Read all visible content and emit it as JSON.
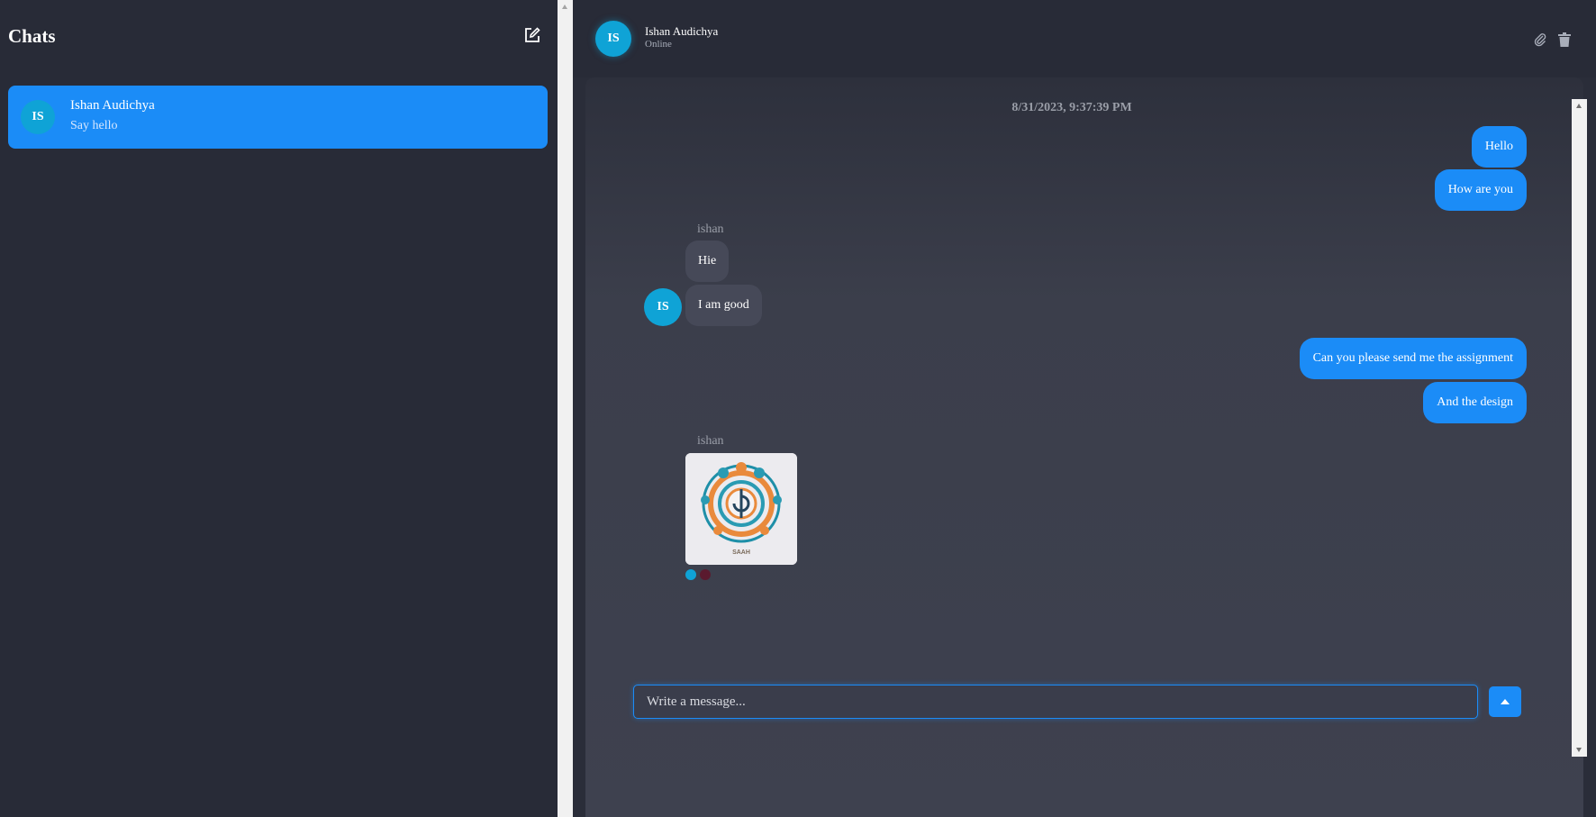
{
  "sidebar": {
    "title": "Chats",
    "compose_icon": "edit-icon",
    "chats": [
      {
        "initials": "IS",
        "name": "Ishan Audichya",
        "preview": "Say hello"
      }
    ]
  },
  "header": {
    "initials": "IS",
    "name": "Ishan Audichya",
    "status": "Online",
    "attach_icon": "paperclip-icon",
    "delete_icon": "trash-icon"
  },
  "conversation": {
    "timestamp": "8/31/2023, 9:37:39 PM",
    "outgoing_1": [
      "Hello",
      "How are you"
    ],
    "incoming_1": {
      "sender": "ishan",
      "initials": "IS",
      "messages": [
        "Hie",
        "I am good"
      ]
    },
    "outgoing_2": [
      "Can you please send me the assignment",
      "And the design"
    ],
    "incoming_2": {
      "sender": "ishan",
      "image_caption": "SAAH"
    }
  },
  "composer": {
    "placeholder": "Write a message...",
    "send_icon": "arrow-up-icon"
  },
  "colors": {
    "accent": "#1b8cf7",
    "avatar": "#0fa3d6",
    "sidebar_bg": "#282b37",
    "incoming_bubble": "#464958",
    "reaction_dot_1": "#0fa3d6",
    "reaction_dot_2": "#5a1a2e"
  }
}
